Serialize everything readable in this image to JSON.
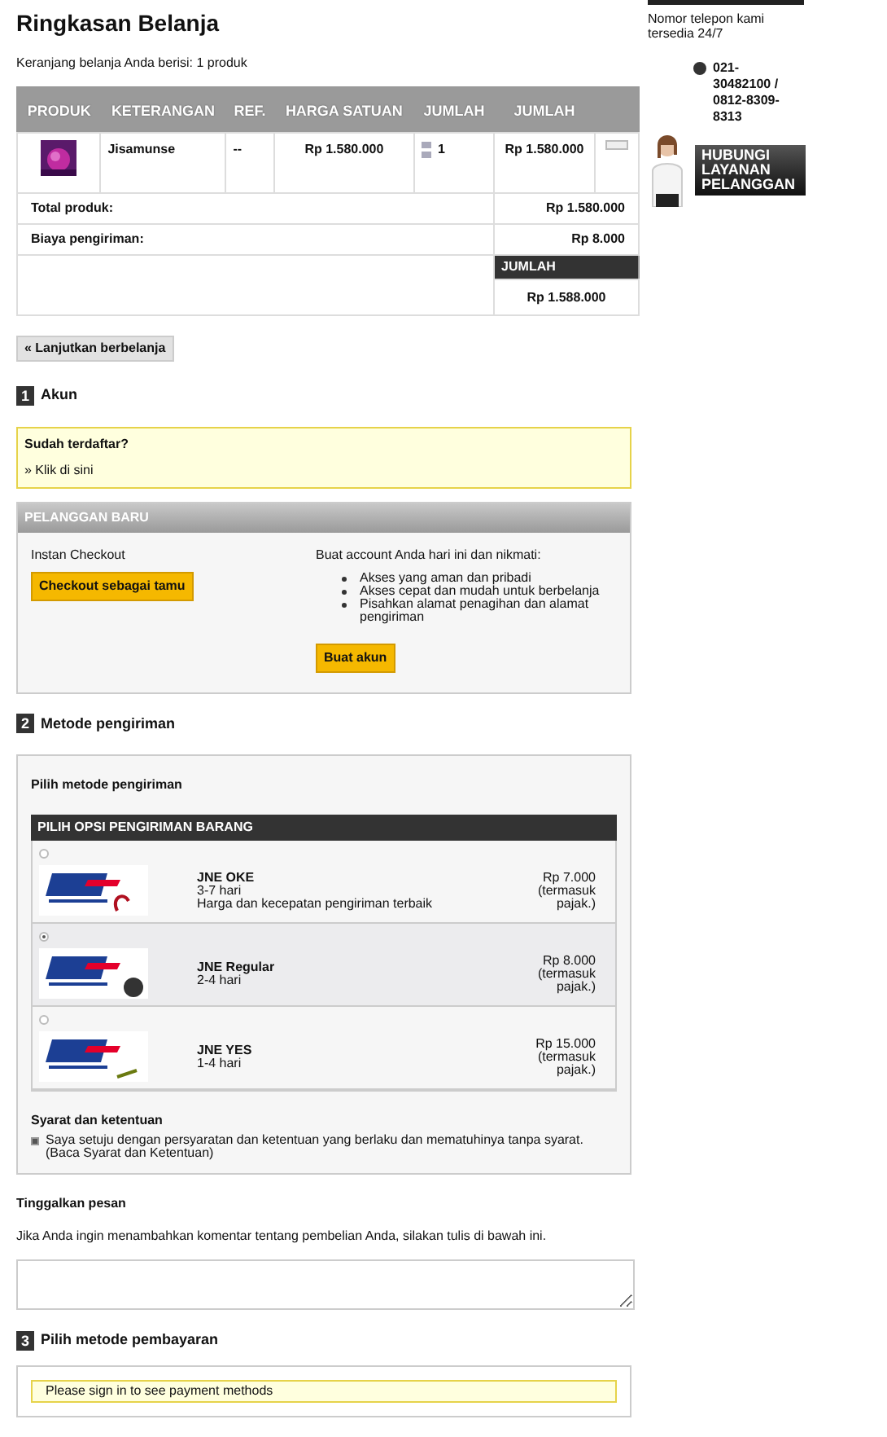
{
  "summary": {
    "title": "Ringkasan Belanja",
    "subtitle": "Keranjang belanja Anda berisi: 1 produk"
  },
  "cart": {
    "columns": [
      "PRODUK",
      "KETERANGAN",
      "REF.",
      "HARGA SATUAN",
      "JUMLAH",
      "JUMLAH"
    ],
    "rows": [
      {
        "description": "Jisamunse",
        "ref": "--",
        "unit_price": "Rp 1.580.000",
        "quantity": "1",
        "total": "Rp 1.580.000"
      }
    ],
    "totals": [
      {
        "label": "Total produk:",
        "value": "Rp 1.580.000"
      },
      {
        "label": "Biaya pengiriman:",
        "value": "Rp 8.000"
      }
    ],
    "grand_total": {
      "label": "JUMLAH",
      "value": "Rp 1.588.000"
    }
  },
  "continue_button": "« Lanjutkan berbelanja",
  "account": {
    "number": "1",
    "title": "Akun",
    "registered": {
      "title": "Sudah terdaftar?",
      "link": "» Klik di sini"
    },
    "new_customer": {
      "title": "PELANGGAN BARU",
      "left_label": "Instan Checkout",
      "guest_button": "Checkout sebagai tamu",
      "right_label": "Buat account Anda hari ini dan nikmati:",
      "benefits": [
        "Akses yang aman dan pribadi",
        "Akses cepat dan mudah untuk berbelanja",
        "Pisahkan alamat penagihan dan alamat pengiriman"
      ],
      "create_button": "Buat akun"
    }
  },
  "shipping": {
    "number": "2",
    "title": "Metode pengiriman",
    "prompt": "Pilih metode pengiriman",
    "table_title": "PILIH OPSI PENGIRIMAN BARANG",
    "options": [
      {
        "name": "JNE OKE",
        "lines": [
          "3-7 hari",
          "Harga dan kecepatan pengiriman terbaik"
        ],
        "price": "Rp 7.000 (termasuk pajak.)",
        "selected": false
      },
      {
        "name": "JNE Regular",
        "lines": [
          "2-4 hari"
        ],
        "price": "Rp 8.000 (termasuk pajak.)",
        "selected": true
      },
      {
        "name": "JNE YES",
        "lines": [
          "1-4 hari"
        ],
        "price": "Rp 15.000 (termasuk pajak.)",
        "selected": false
      }
    ],
    "terms": {
      "title": "Syarat dan ketentuan",
      "text": "Saya setuju dengan persyaratan dan ketentuan yang berlaku dan mematuhinya tanpa syarat.",
      "link": "(Baca Syarat dan Ketentuan)",
      "checked": true
    }
  },
  "message": {
    "title": "Tinggalkan pesan",
    "hint": "Jika Anda ingin menambahkan komentar tentang pembelian Anda, silakan tulis di bawah ini."
  },
  "payment": {
    "number": "3",
    "title": "Pilih metode pembayaran",
    "notice": "Please sign in to see payment methods"
  },
  "sidebar": {
    "phone_label": "Nomor telepon kami tersedia 24/7",
    "phone": "021-30482100 / 0812-8309-8313",
    "contact_button": "HUBUNGI LAYANAN PELANGGAN"
  }
}
